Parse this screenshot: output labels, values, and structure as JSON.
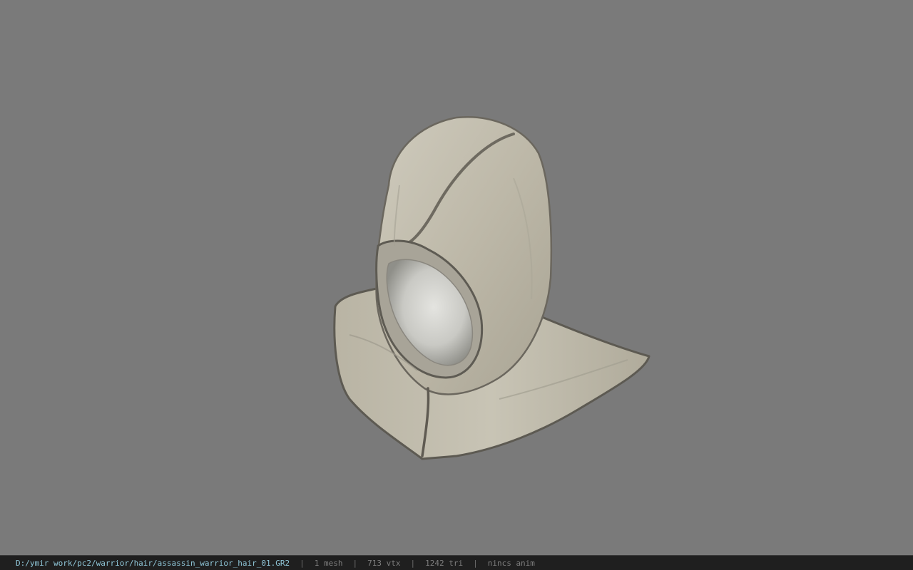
{
  "viewport": {
    "background": "#7a7a7a",
    "model": "hood-mesh"
  },
  "status": {
    "file_path": "D:/ymir work/pc2/warrior/hair/assassin_warrior_hair_01.GR2",
    "mesh_count": "1 mesh",
    "vertex_count": "713 vtx",
    "triangle_count": "1242 tri",
    "anim_status": "nincs anim",
    "separator": "|"
  },
  "colors": {
    "statusbar_bg": "#1f1f1f",
    "path_text": "#8fc6d8",
    "info_text": "#7e7e7e"
  }
}
